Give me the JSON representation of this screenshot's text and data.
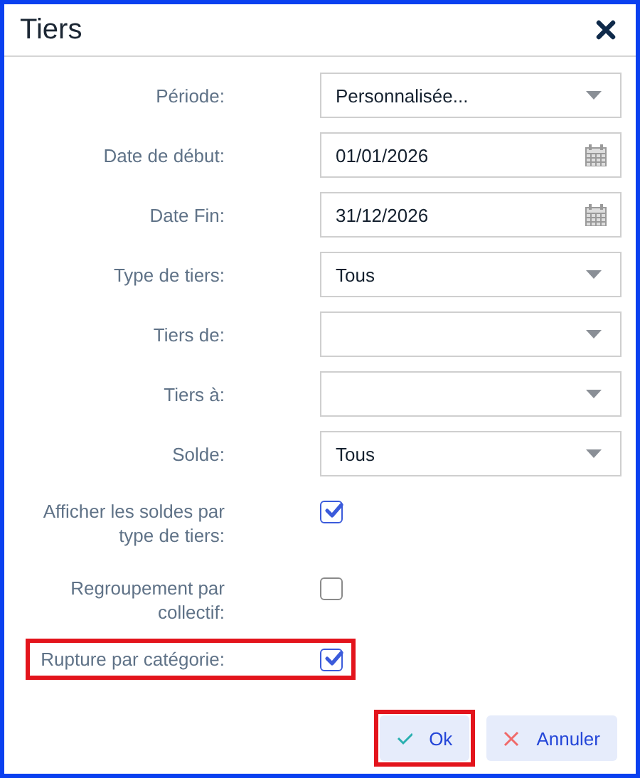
{
  "window": {
    "title": "Tiers"
  },
  "fields": [
    {
      "kind": "select",
      "label": "Période:",
      "value": "Personnalisée...",
      "highlighted": false
    },
    {
      "kind": "date",
      "label": "Date de début:",
      "value": "01/01/2026",
      "highlighted": false
    },
    {
      "kind": "date",
      "label": "Date Fin:",
      "value": "31/12/2026",
      "highlighted": false
    },
    {
      "kind": "select",
      "label": "Type de tiers:",
      "value": "Tous",
      "highlighted": false
    },
    {
      "kind": "select",
      "label": "Tiers de:",
      "highlighted": false
    },
    {
      "kind": "select",
      "label": "Tiers à:",
      "highlighted": false
    },
    {
      "kind": "select",
      "label": "Solde:",
      "value": "Tous",
      "highlighted": false
    },
    {
      "kind": "checkbox",
      "label": "Afficher les soldes par type de tiers:",
      "checked": true,
      "highlighted": false
    },
    {
      "kind": "checkbox",
      "label": "Regroupement par collectif:",
      "checked": false,
      "highlighted": false
    },
    {
      "kind": "checkbox",
      "label": "Rupture par catégorie:",
      "checked": true,
      "highlighted": true
    }
  ],
  "buttons": [
    {
      "kind": "ok",
      "label": "Ok",
      "highlighted": true
    },
    {
      "kind": "cancel",
      "label": "Annuler",
      "highlighted": false
    }
  ]
}
